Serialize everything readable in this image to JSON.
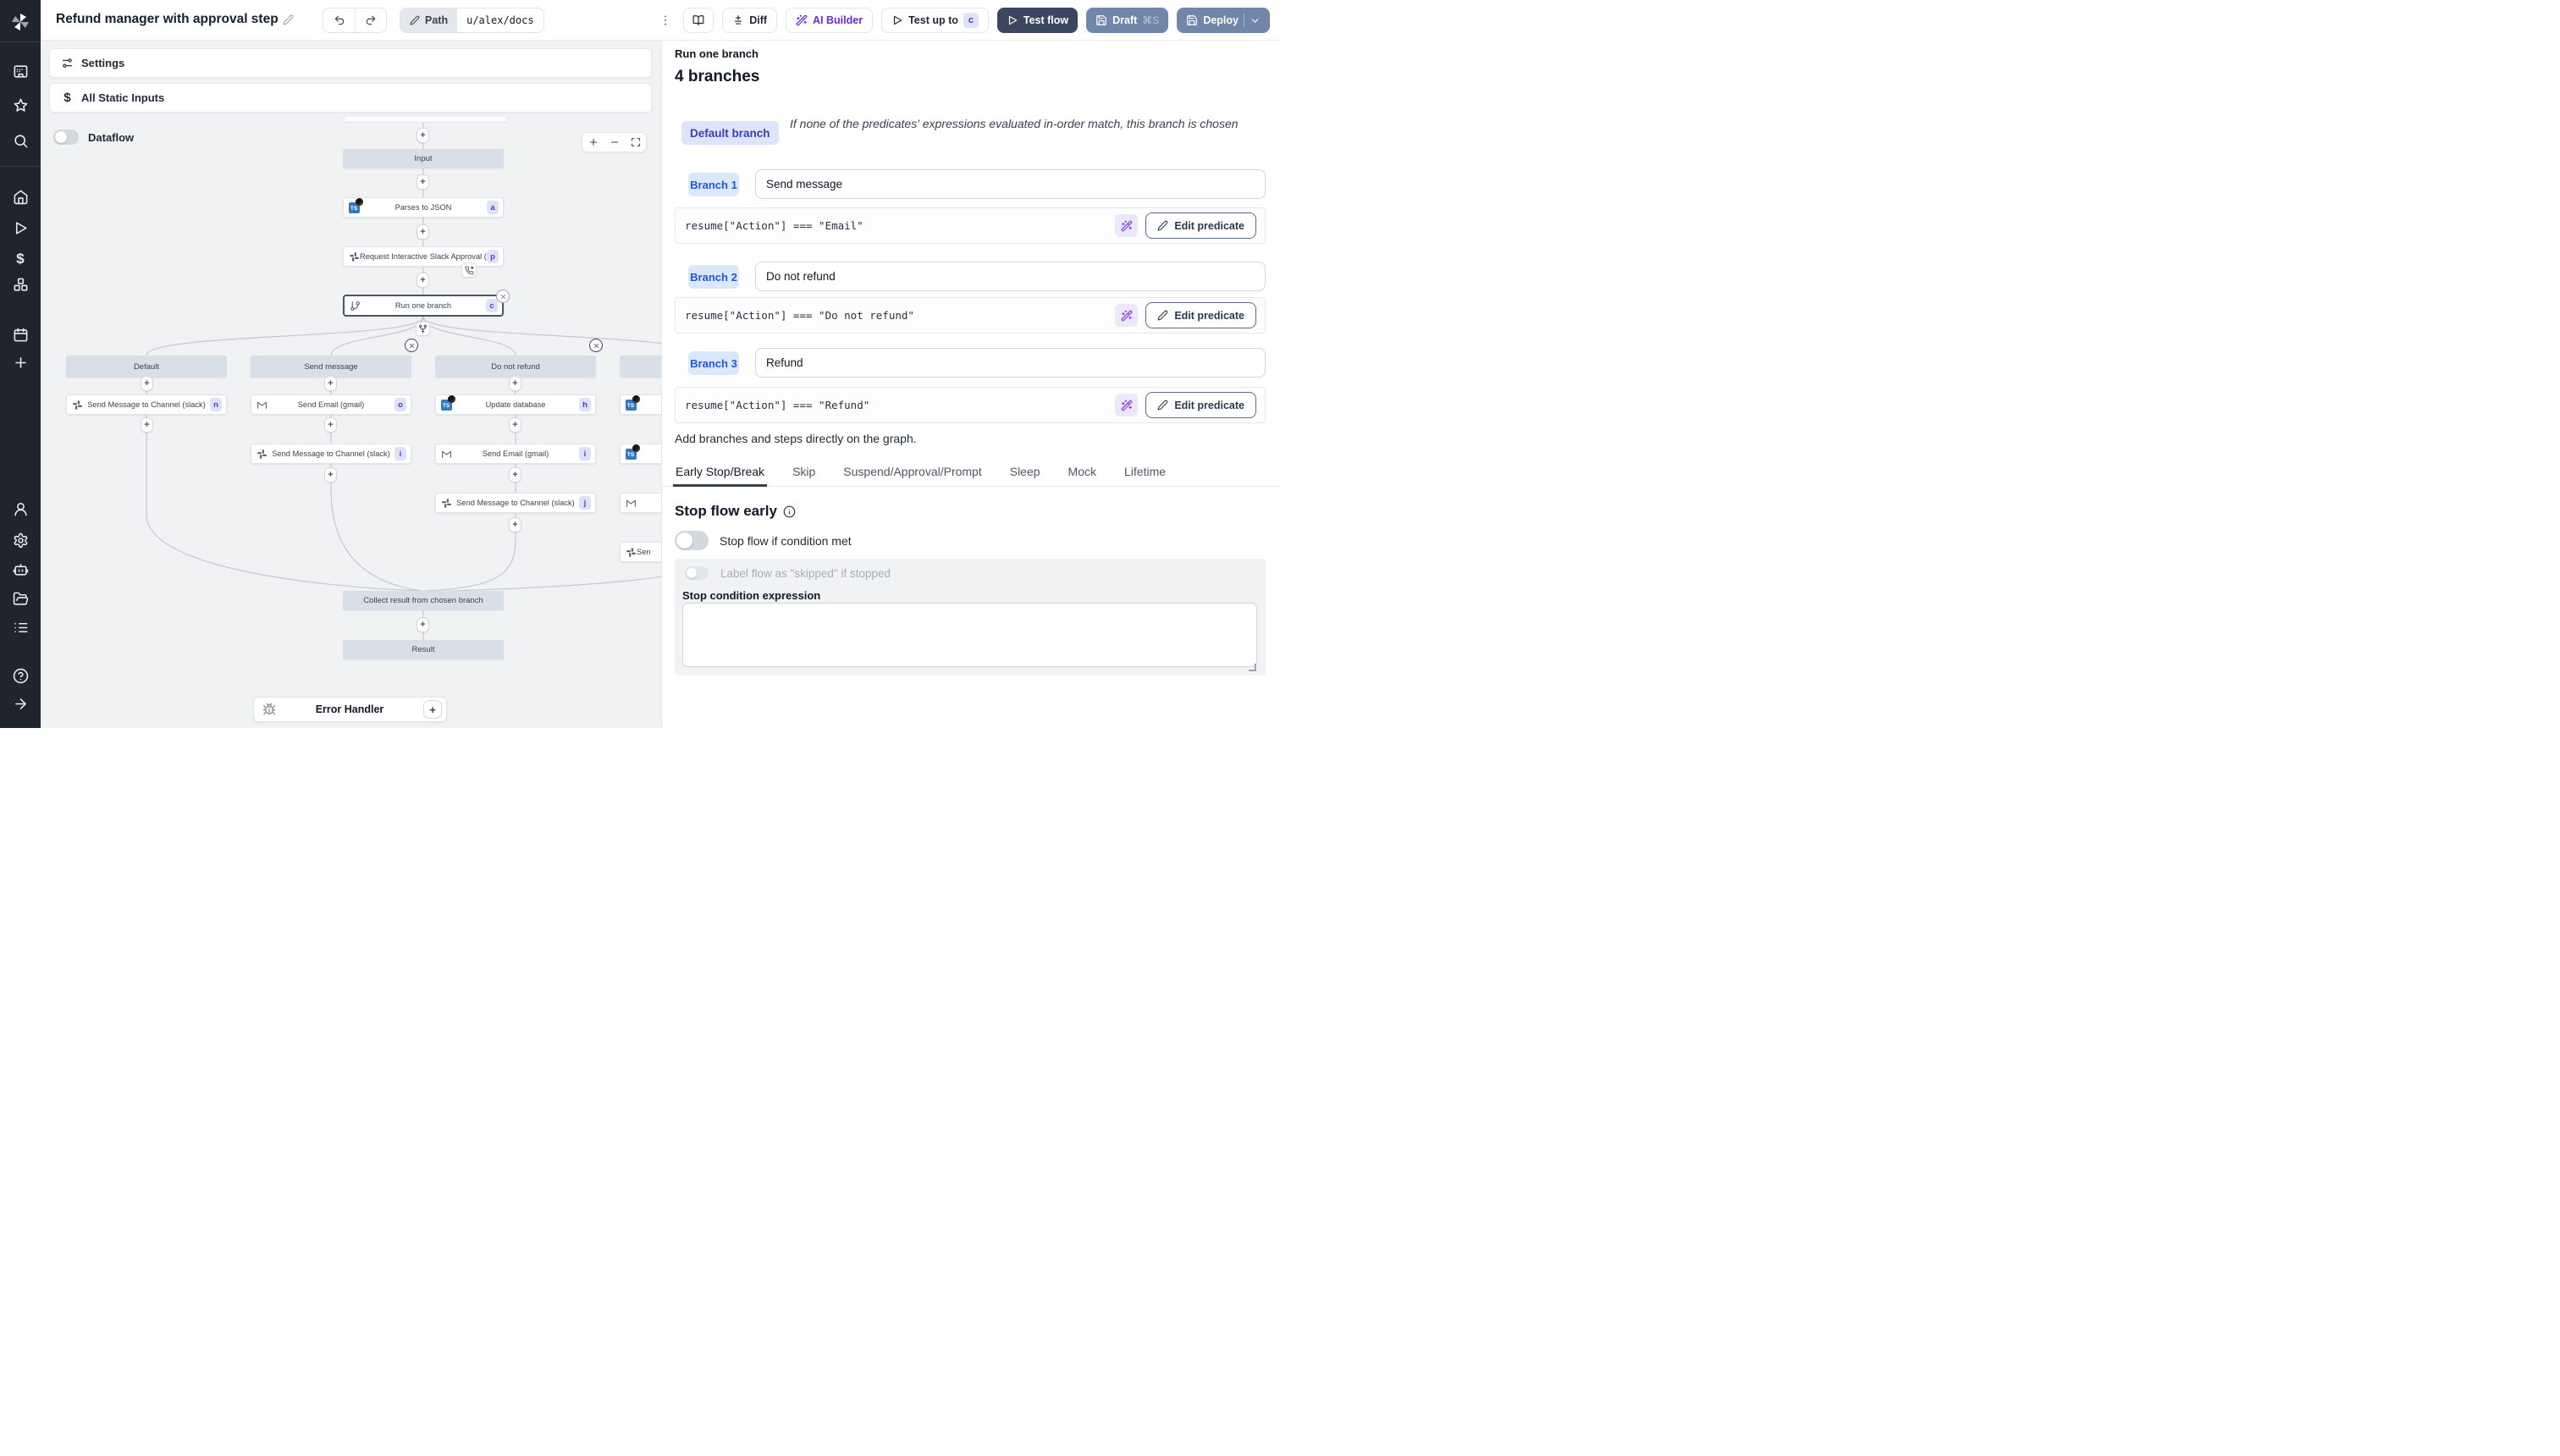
{
  "topbar": {
    "title": "Refund manager with approval step",
    "path_label": "Path",
    "path_value": "u/alex/docs",
    "diff_label": "Diff",
    "ai_builder_label": "AI Builder",
    "test_up_to_label": "Test up to",
    "test_up_to_badge": "c",
    "test_flow_label": "Test flow",
    "draft_label": "Draft",
    "draft_shortcut": "⌘S",
    "deploy_label": "Deploy"
  },
  "sidebar": {
    "icons_top": [
      "windmill-logo",
      "app-window",
      "star",
      "search"
    ],
    "icons_mid": [
      "home",
      "play",
      "dollar",
      "boxes",
      "calendar",
      "plus"
    ],
    "icons_low": [
      "user",
      "gear",
      "bot",
      "folder-open",
      "list"
    ],
    "icons_bottom": [
      "help-circle",
      "arrow-right"
    ]
  },
  "left_panel": {
    "settings_label": "Settings",
    "static_inputs_label": "All Static Inputs",
    "dataflow_label": "Dataflow",
    "zoom_controls": [
      "zoom-in",
      "zoom-out",
      "fit-view"
    ]
  },
  "graph": {
    "input_label": "Input",
    "chain": [
      {
        "label": "Parses to JSON",
        "badge": "a",
        "icon": "typescript"
      },
      {
        "label": "Request Interactive Slack Approval (...",
        "badge": "p",
        "icon": "slack"
      },
      {
        "label": "Run one branch",
        "badge": "c",
        "icon": "git-branch"
      }
    ],
    "branches": [
      {
        "header": "Default",
        "steps": [
          {
            "label": "Send Message to Channel (slack)",
            "badge": "n",
            "icon": "slack"
          }
        ]
      },
      {
        "header": "Send message",
        "steps": [
          {
            "label": "Send Email (gmail)",
            "badge": "o",
            "icon": "gmail"
          },
          {
            "label": "Send Message to Channel (slack)",
            "badge": "i",
            "icon": "slack"
          }
        ]
      },
      {
        "header": "Do not refund",
        "steps": [
          {
            "label": "Update database",
            "badge": "h",
            "icon": "typescript"
          },
          {
            "label": "Send Email (gmail)",
            "badge": "i",
            "icon": "gmail"
          },
          {
            "label": "Send Message to Channel (slack)",
            "badge": "j",
            "icon": "slack"
          }
        ]
      },
      {
        "header": "",
        "steps": [
          {
            "label": "",
            "icon": "typescript"
          },
          {
            "label": "",
            "icon": "typescript"
          },
          {
            "label": "",
            "icon": "gmail"
          },
          {
            "label": "Sen",
            "icon": "slack"
          }
        ]
      }
    ],
    "collect_label": "Collect result from chosen branch",
    "result_label": "Result",
    "error_handler_label": "Error Handler"
  },
  "right_panel": {
    "subtitle": "Run one branch",
    "title": "4 branches",
    "default_branch": {
      "badge": "Default branch",
      "description": "If none of the predicates' expressions evaluated in-order match, this branch is chosen"
    },
    "branches": [
      {
        "badge": "Branch 1",
        "summary": "Send message",
        "predicate": "resume[\"Action\"] === \"Email\"",
        "edit_label": "Edit predicate"
      },
      {
        "badge": "Branch 2",
        "summary": "Do not refund",
        "predicate": "resume[\"Action\"] === \"Do not refund\"",
        "edit_label": "Edit predicate"
      },
      {
        "badge": "Branch 3",
        "summary": "Refund",
        "predicate": "resume[\"Action\"] === \"Refund\"",
        "edit_label": "Edit predicate"
      }
    ],
    "hint": "Add branches and steps directly on the graph.",
    "tabs": [
      "Early Stop/Break",
      "Skip",
      "Suspend/Approval/Prompt",
      "Sleep",
      "Mock",
      "Lifetime"
    ],
    "active_tab": "Early Stop/Break",
    "early_stop": {
      "heading": "Stop flow early",
      "condition_toggle_label": "Stop flow if condition met",
      "skipped_toggle_label": "Label flow as \"skipped\" if stopped",
      "expression_label": "Stop condition expression",
      "expression_value": ""
    }
  },
  "colors": {
    "sidebar_bg": "#1f2430",
    "canvas_bg": "#f1f2f4",
    "node_gray": "#d9dfe8",
    "accent_indigo": "#4640cc",
    "test_flow_bg": "#3c4660",
    "deploy_bg": "#7187a9",
    "ai_purple": "#6d28d9",
    "branch_badge_blue": "#2456d0"
  }
}
